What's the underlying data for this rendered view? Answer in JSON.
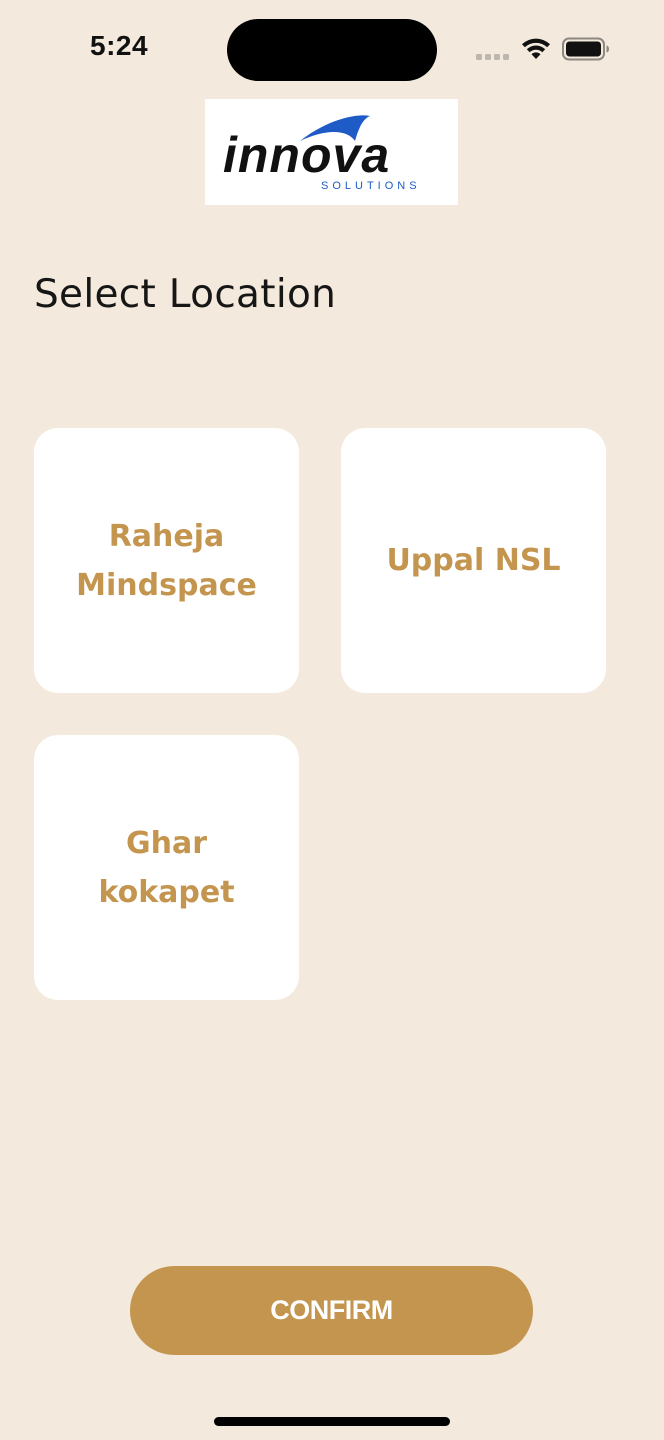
{
  "status_bar": {
    "time": "5:24"
  },
  "logo": {
    "name": "innova",
    "tagline": "SOLUTIONS"
  },
  "page": {
    "title": "Select Location"
  },
  "locations": [
    {
      "label": "Raheja\nMindspace"
    },
    {
      "label": "Uppal NSL"
    },
    {
      "label": "Ghar\nkokapet"
    }
  ],
  "actions": {
    "confirm_label": "CONFIRM"
  },
  "colors": {
    "background": "#F3E9DC",
    "accent": "#C4954E",
    "card": "#FFFFFF",
    "logo_blue": "#1E5BC6"
  }
}
